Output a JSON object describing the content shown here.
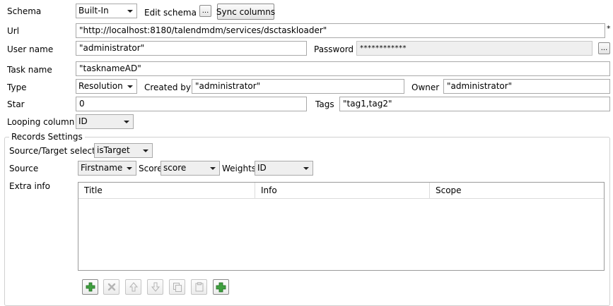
{
  "schema": {
    "label": "Schema",
    "value": "Built-In",
    "edit_label": "Edit schema",
    "dots": "...",
    "sync_label": "Sync columns"
  },
  "url": {
    "label": "Url",
    "value": "\"http://localhost:8180/talendmdm/services/dsctaskloader\"",
    "required_mark": "*"
  },
  "username": {
    "label": "User name",
    "value": "\"administrator\""
  },
  "password": {
    "label": "Password",
    "value": "************",
    "dots": "..."
  },
  "taskname": {
    "label": "Task name",
    "value": "\"tasknameAD\""
  },
  "type": {
    "label": "Type",
    "value": "Resolution"
  },
  "created_by": {
    "label": "Created by",
    "value": "\"administrator\""
  },
  "owner": {
    "label": "Owner",
    "value": "\"administrator\""
  },
  "star": {
    "label": "Star",
    "value": "0"
  },
  "tags": {
    "label": "Tags",
    "value": "\"tag1,tag2\""
  },
  "looping": {
    "label": "Looping column",
    "value": "ID"
  },
  "records": {
    "title": "Records Settings",
    "selector_label": "Source/Target selector",
    "selector_value": "isTarget",
    "source_label": "Source",
    "source_value": "Firstname",
    "score_label": "Score",
    "score_value": "score",
    "weights_label": "Weights",
    "weights_value": "ID",
    "extra_label": "Extra info",
    "columns": [
      "Title",
      "Info",
      "Scope"
    ]
  },
  "toolbar": {
    "add_icon": "plus-icon",
    "remove_icon": "x-icon",
    "up_icon": "arrow-up-icon",
    "down_icon": "arrow-down-icon",
    "copy_icon": "copy-icon",
    "paste_icon": "paste-icon",
    "add_all_icon": "plus-green-icon",
    "accent": "#3fa03f"
  }
}
